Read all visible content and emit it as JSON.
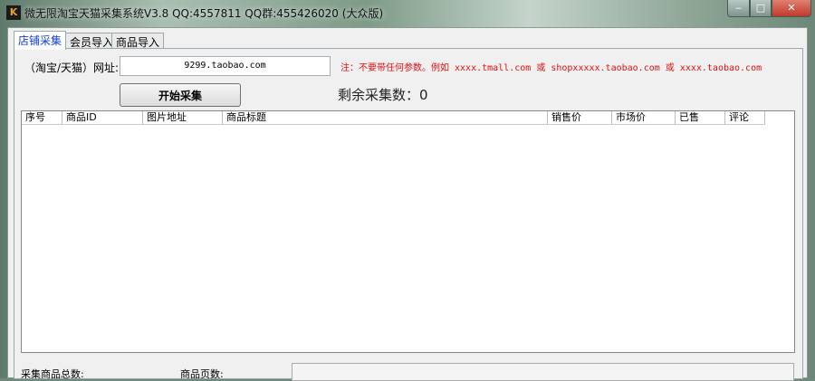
{
  "window": {
    "title": "微无限淘宝天猫采集系统V3.8 QQ:4557811 QQ群:455426020 (大众版)",
    "app_icon": "K",
    "minimize": "‒",
    "maximize": "□",
    "close": "✕"
  },
  "tabs": [
    {
      "label": "店铺采集",
      "active": true
    },
    {
      "label": "会员导入"
    },
    {
      "label": "商品导入"
    }
  ],
  "form": {
    "url_label": "（淘宝/天猫）网址:",
    "url_value": "9299.taobao.com",
    "note": "注：不要带任何参数。例如 xxxx.tmall.com 或 shopxxxxx.taobao.com 或 xxxx.taobao.com",
    "start_button": "开始采集",
    "remaining": "剩余采集数：0"
  },
  "table": {
    "columns": [
      "序号",
      "商品ID",
      "图片地址",
      "商品标题",
      "销售价",
      "市场价",
      "已售",
      "评论"
    ],
    "rows": []
  },
  "footer": {
    "total_label": "采集商品总数:",
    "pages_label": "商品页数:"
  }
}
